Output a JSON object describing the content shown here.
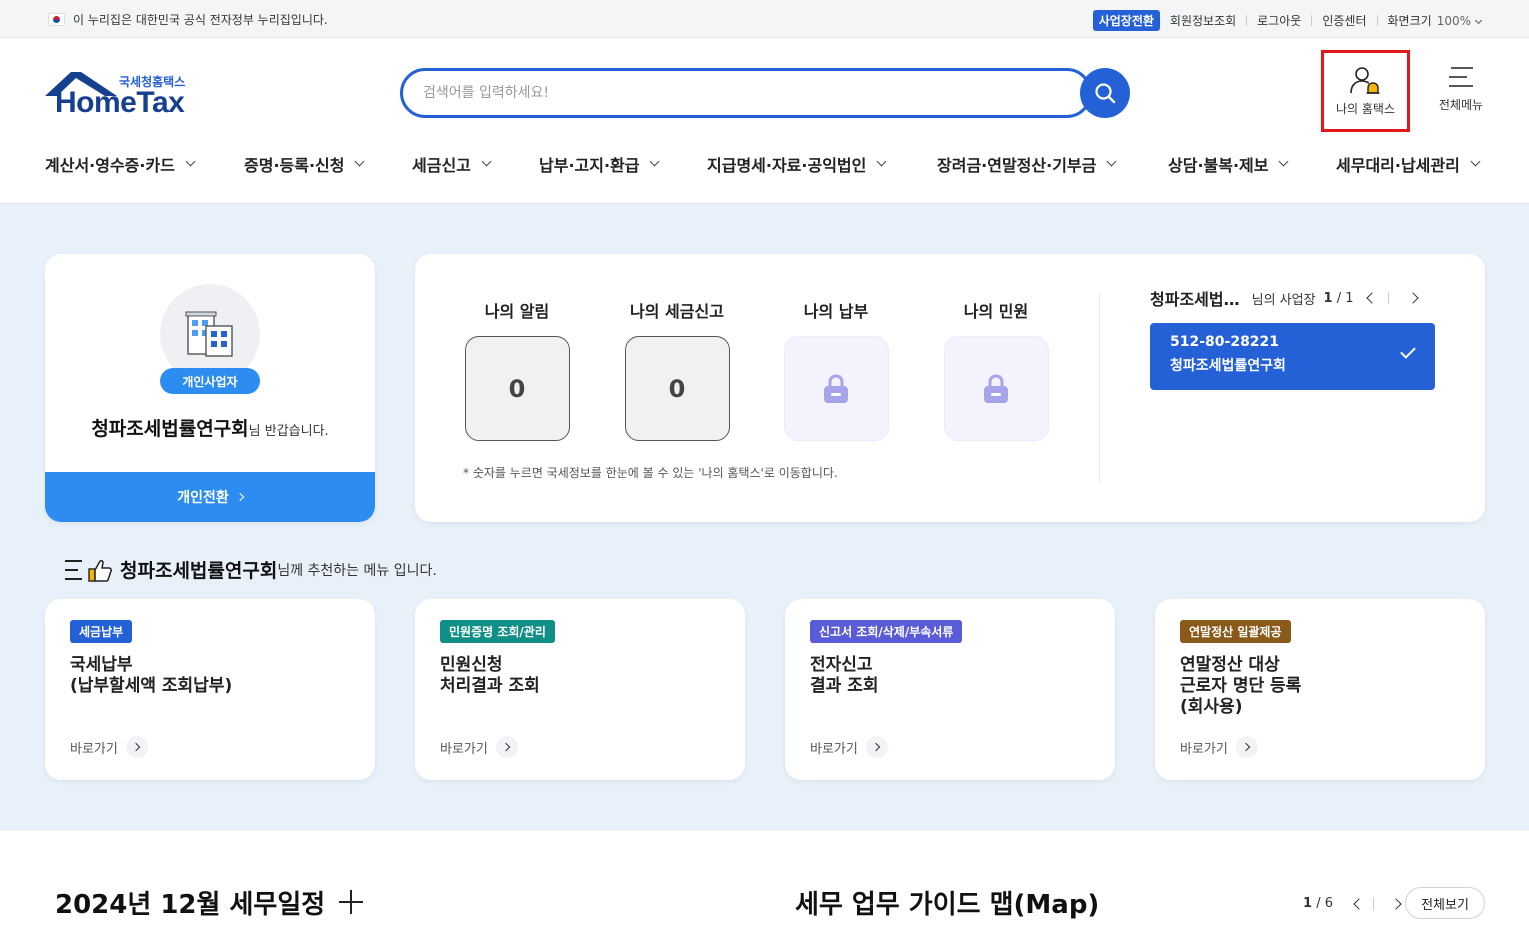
{
  "util": {
    "gov_notice": "이 누리집은 대한민국 공식 전자정부 누리집입니다.",
    "biz_switch": "사업장전환",
    "member_info": "회원정보조회",
    "logout": "로그아웃",
    "cert_center": "인증센터",
    "screen_size_label": "화면크기",
    "zoom_value": "100%"
  },
  "logo": {
    "sub": "국세청홈택스",
    "main": "HomeTax"
  },
  "search": {
    "placeholder": "검색어를 입력하세요!",
    "value": ""
  },
  "header": {
    "my_hometax": "나의 홈택스",
    "full_menu": "전체메뉴"
  },
  "gnb": [
    "계산서·영수증·카드",
    "증명·등록·신청",
    "세금신고",
    "납부·고지·환급",
    "지급명세·자료·공익법인",
    "장려금·연말정산·기부금",
    "상담·불복·제보",
    "세무대리·납세관리"
  ],
  "profile": {
    "type_badge": "개인사업자",
    "name": "청파조세법률연구회",
    "suffix": "님 반갑습니다.",
    "switch_label": "개인전환"
  },
  "status": {
    "items": [
      {
        "title": "나의 알림",
        "value": "0"
      },
      {
        "title": "나의 세금신고",
        "value": "0"
      },
      {
        "title": "나의 납부",
        "value": ""
      },
      {
        "title": "나의 민원",
        "value": ""
      }
    ],
    "note": "* 숫자를 누르면 국세정보를 한눈에 볼 수 있는 '나의 홈택스'로 이동합니다."
  },
  "business": {
    "short_name": "청파조세법…",
    "suffix": "님의 사업장",
    "page_current": "1",
    "page_total": "/ 1",
    "selected_number": "512-80-28221",
    "selected_name": "청파조세법률연구회"
  },
  "recommend": {
    "name": "청파조세법률연구회",
    "suffix": "님께 추천하는 메뉴 입니다.",
    "cards": [
      {
        "badge": "세금납부",
        "badge_color": "#2461d6",
        "title_lines": [
          "국세납부",
          "(납부할세액 조회납부)"
        ],
        "go": "바로가기"
      },
      {
        "badge": "민원증명 조회/관리",
        "badge_color": "#0f8f86",
        "title_lines": [
          "민원신청",
          "처리결과 조회"
        ],
        "go": "바로가기"
      },
      {
        "badge": "신고서 조회/삭제/부속서류",
        "badge_color": "#5a5bd6",
        "title_lines": [
          "전자신고",
          "결과 조회"
        ],
        "go": "바로가기"
      },
      {
        "badge": "연말정산 일괄제공",
        "badge_color": "#8a5a1a",
        "title_lines": [
          "연말정산 대상",
          "근로자 명단 등록",
          "(회사용)"
        ],
        "go": "바로가기"
      }
    ]
  },
  "schedule": {
    "title": "2024년 12월 세무일정"
  },
  "guide": {
    "title": "세무 업무 가이드 맵(Map)",
    "page_current": "1",
    "page_total": "/ 6",
    "view_all": "전체보기"
  },
  "colors": {
    "primary": "#2461d6",
    "accent": "#2d8cf0",
    "highlight_border": "#e4161d",
    "bg_light": "#e8f1fa"
  }
}
